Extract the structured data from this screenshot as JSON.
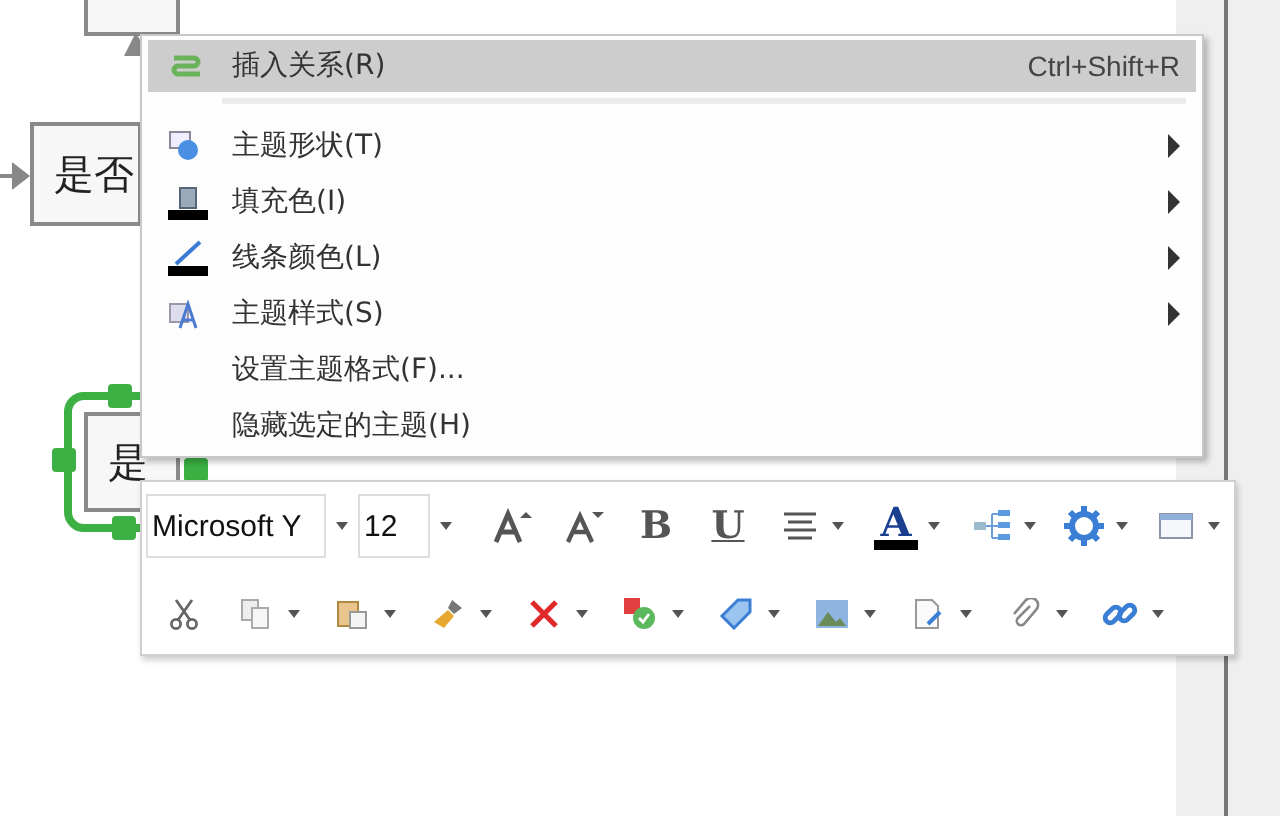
{
  "canvas": {
    "nodes": [
      {
        "label": "是否",
        "selected": false
      },
      {
        "label": "是",
        "selected": true
      }
    ]
  },
  "context_menu": {
    "items": [
      {
        "label": "插入关系(R)",
        "shortcut": "Ctrl+Shift+R",
        "submenu": false,
        "selected": true
      },
      {
        "label": "主题形状(T)",
        "submenu": true,
        "selected": false
      },
      {
        "label": "填充色(I)",
        "submenu": true,
        "selected": false
      },
      {
        "label": "线条颜色(L)",
        "submenu": true,
        "selected": false
      },
      {
        "label": "主题样式(S)",
        "submenu": true,
        "selected": false
      },
      {
        "label": "设置主题格式(F)...",
        "submenu": false,
        "selected": false
      },
      {
        "label": "隐藏选定的主题(H)",
        "submenu": false,
        "selected": false
      }
    ]
  },
  "toolbar": {
    "font": {
      "value": "Microsoft Y"
    },
    "size": {
      "value": "12"
    },
    "row_1": [
      {
        "kind": "icon",
        "dropdown": false
      },
      {
        "kind": "icon",
        "dropdown": false
      },
      {
        "kind": "text",
        "label": "B",
        "dropdown": false
      },
      {
        "kind": "text",
        "label": "U",
        "dropdown": false
      },
      {
        "kind": "icon",
        "dropdown": true
      },
      {
        "kind": "text",
        "label": "A",
        "dropdown": true
      },
      {
        "kind": "icon",
        "dropdown": true
      },
      {
        "kind": "icon",
        "dropdown": true
      },
      {
        "kind": "icon",
        "dropdown": true
      }
    ],
    "row_2": [
      {
        "kind": "icon",
        "dropdown": false
      },
      {
        "kind": "icon",
        "dropdown": true
      },
      {
        "kind": "icon",
        "dropdown": true
      },
      {
        "kind": "icon",
        "dropdown": true
      },
      {
        "kind": "icon",
        "dropdown": true
      },
      {
        "kind": "icon",
        "dropdown": true
      },
      {
        "kind": "icon",
        "dropdown": true
      },
      {
        "kind": "icon",
        "dropdown": true
      },
      {
        "kind": "icon",
        "dropdown": true
      },
      {
        "kind": "icon",
        "dropdown": true
      },
      {
        "kind": "icon",
        "dropdown": true
      }
    ]
  }
}
